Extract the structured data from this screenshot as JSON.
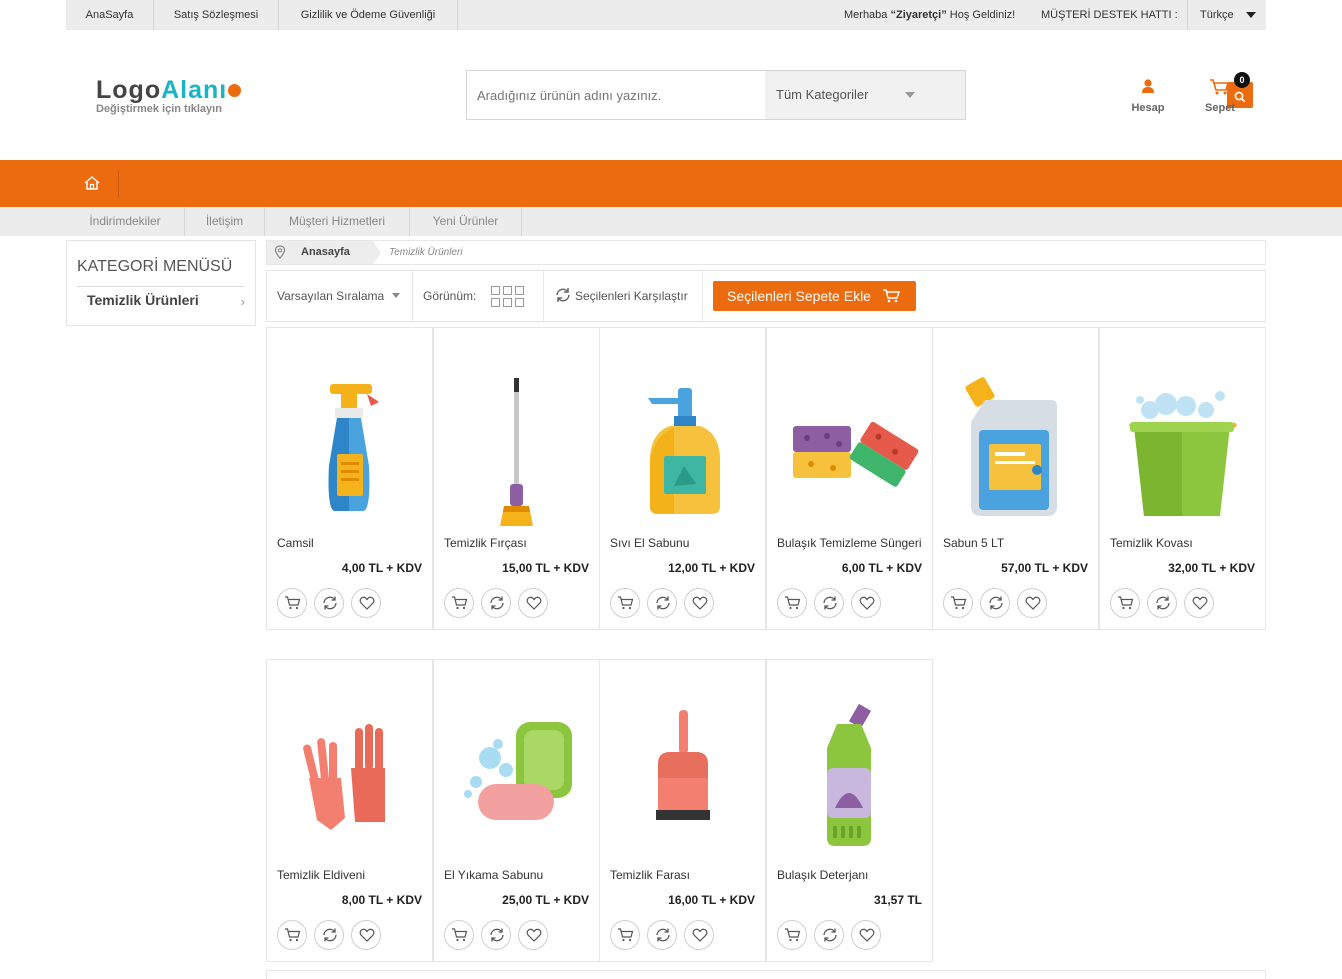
{
  "topbar": {
    "links": [
      "AnaSayfa",
      "Satış Sözleşmesi",
      "Gizlilik ve Ödeme Güvenliği"
    ],
    "greeting_pre": "Merhaba ",
    "greeting_user": "“Ziyaretçi”",
    "greeting_post": " Hoş Geldiniz!",
    "support": "MÜŞTERİ DESTEK HATTI :",
    "language": "Türkçe"
  },
  "header": {
    "logo_part1": "Logo",
    "logo_part2": "Alanı",
    "logo_sub": "Değiştirmek için tıklayın",
    "search_placeholder": "Aradığınız ürünün adını yazınız.",
    "category_select": "Tüm Kategoriler",
    "account_label": "Hesap",
    "cart_label": "Sepet",
    "cart_count": "0"
  },
  "subnav": [
    "İndirimdekiler",
    "İletişim",
    "Müşteri Hizmetleri",
    "Yeni Ürünler"
  ],
  "sidebar": {
    "title": "KATEGORİ MENÜSÜ",
    "item": "Temizlik Ürünleri",
    "chevron": "›"
  },
  "breadcrumb": {
    "home": "Anasayfa",
    "current": "Temizlik Ürünleri"
  },
  "toolbar": {
    "sort": "Varsayılan Sıralama",
    "view": "Görünüm:",
    "compare": "Seçilenleri Karşılaştır",
    "add_selected": "Seçilenleri Sepete Ekle"
  },
  "colors": {
    "accent": "#ec6b0e",
    "topbar_bg": "#ececec"
  },
  "products": [
    {
      "name": "Camsil",
      "price": "4,00 TL + KDV",
      "icon": "spray-bottle-icon"
    },
    {
      "name": "Temizlik Fırçası",
      "price": "15,00 TL + KDV",
      "icon": "broom-icon"
    },
    {
      "name": "Sıvı El Sabunu",
      "price": "12,00 TL + KDV",
      "icon": "soap-dispenser-icon"
    },
    {
      "name": "Bulaşık Temizleme Süngeri",
      "price": "6,00 TL + KDV",
      "icon": "sponge-icon"
    },
    {
      "name": "Sabun 5 LT",
      "price": "57,00 TL + KDV",
      "icon": "detergent-jug-icon"
    },
    {
      "name": "Temizlik Kovası",
      "price": "32,00 TL + KDV",
      "icon": "bucket-icon"
    },
    {
      "name": "Temizlik Eldiveni",
      "price": "8,00 TL + KDV",
      "icon": "gloves-icon"
    },
    {
      "name": "El Yıkama Sabunu",
      "price": "25,00 TL + KDV",
      "icon": "soap-bar-icon"
    },
    {
      "name": "Temizlik Farası",
      "price": "16,00 TL + KDV",
      "icon": "dustpan-icon"
    },
    {
      "name": "Bulaşık Deterjanı",
      "price": "31,57 TL",
      "icon": "detergent-bottle-icon"
    }
  ]
}
